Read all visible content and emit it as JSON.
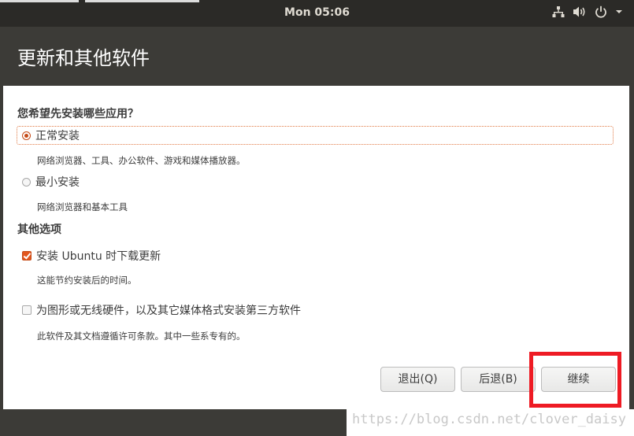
{
  "topbar": {
    "clock": "Mon 05:06"
  },
  "window": {
    "title": "更新和其他软件"
  },
  "apps_section": {
    "heading": "您希望先安装哪些应用？",
    "options": [
      {
        "label": "正常安装",
        "description": "网络浏览器、工具、办公软件、游戏和媒体播放器。",
        "checked": true
      },
      {
        "label": "最小安装",
        "description": "网络浏览器和基本工具",
        "checked": false
      }
    ]
  },
  "other_section": {
    "heading": "其他选项",
    "options": [
      {
        "label": "安装 Ubuntu 时下载更新",
        "description": "这能节约安装后的时间。",
        "checked": true
      },
      {
        "label": "为图形或无线硬件，以及其它媒体格式安装第三方软件",
        "description": "此软件及其文档遵循许可条款。其中一些系专有的。",
        "checked": false
      }
    ]
  },
  "buttons": {
    "quit": "退出(Q)",
    "back": "后退(B)",
    "continue": "继续"
  },
  "watermark": "https://blog.csdn.net/clover_daisy",
  "colors": {
    "accent": "#e2571e",
    "highlight": "#ee1b24",
    "header_bg": "#3c3b37"
  }
}
